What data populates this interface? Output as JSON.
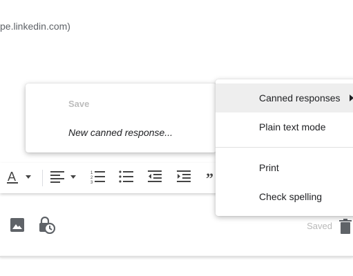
{
  "compose": {
    "recipient_partial": "pe.linkedin.com)",
    "saved_status": "Saved"
  },
  "canned_submenu": {
    "items": [
      {
        "label": "Save",
        "disabled": true
      },
      {
        "label": "New canned response...",
        "disabled": false
      }
    ]
  },
  "more_options_menu": {
    "items": [
      {
        "label": "Canned responses",
        "has_submenu": true,
        "highlighted": true
      },
      {
        "label": "Plain text mode"
      },
      {
        "label": "Print"
      },
      {
        "label": "Check spelling"
      }
    ]
  },
  "toolbar_icons": [
    "text-color-icon",
    "align-icon",
    "numbered-list-icon",
    "bulleted-list-icon",
    "indent-less-icon",
    "indent-more-icon",
    "quote-icon"
  ],
  "bottom_icons": [
    "insert-photo-icon",
    "confidential-mode-icon",
    "delete-icon"
  ],
  "colors": {
    "menu_highlight": "#eeeeee",
    "disabled_text": "#bdbdbd",
    "saved_text": "#b8b8b8",
    "icon": "#5f6368"
  }
}
